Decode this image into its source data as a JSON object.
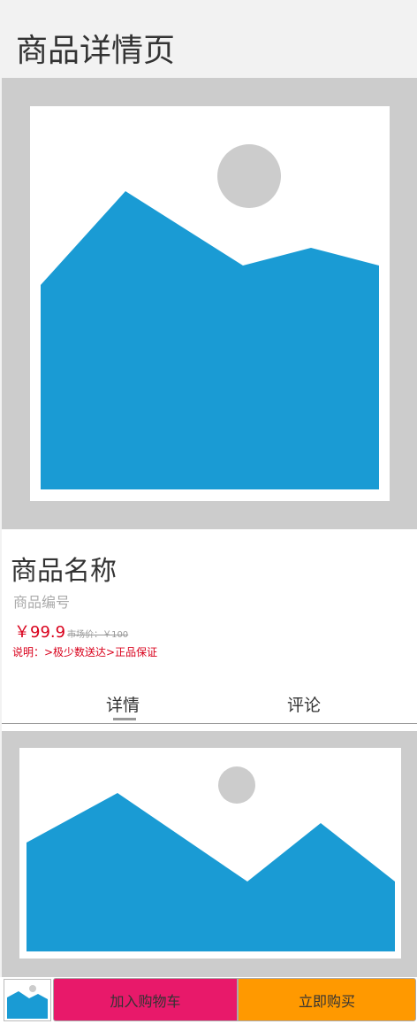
{
  "page": {
    "title": "商品详情页"
  },
  "product": {
    "name": "商品名称",
    "code": "商品编号",
    "price": "￥99.9",
    "market_price": "市场价：￥100",
    "description": "说明：>极少数送达>正品保证"
  },
  "tabs": [
    {
      "label": "详情",
      "active": true
    },
    {
      "label": "评论",
      "active": false
    }
  ],
  "actions": {
    "add_to_cart": "加入购物车",
    "buy_now": "立即购买"
  },
  "colors": {
    "price": "#d9001b",
    "add_to_cart_bg": "#e8196a",
    "buy_now_bg": "#ff9900",
    "image_placeholder": "#1a9bd4",
    "placeholder_frame": "#cccccc"
  },
  "icons": {
    "main_image": "image-placeholder-icon",
    "detail_image": "image-placeholder-icon",
    "thumbnail": "image-placeholder-icon"
  }
}
